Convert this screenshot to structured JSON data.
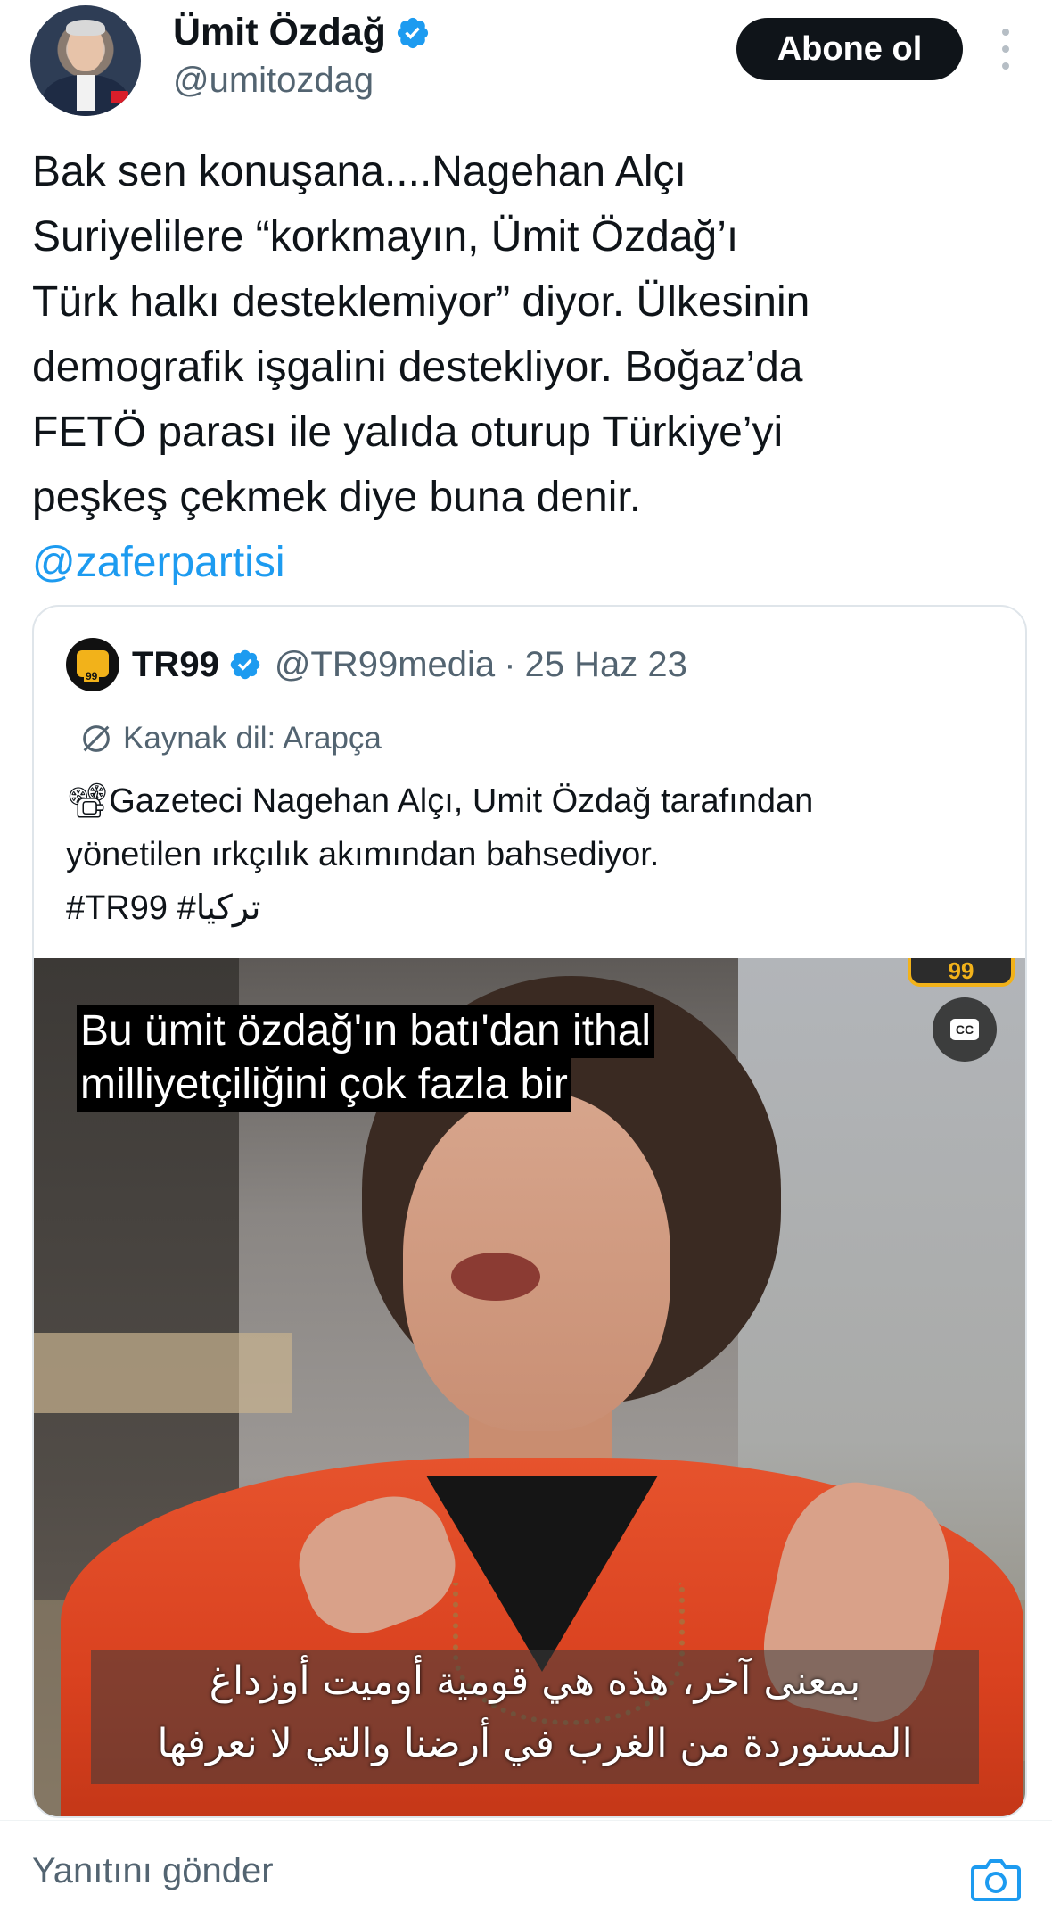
{
  "author": {
    "display_name": "Ümit Özdağ",
    "handle": "@umitozdag",
    "verified_icon": "verified-badge-icon"
  },
  "follow_button": {
    "label": "Abone ol"
  },
  "tweet": {
    "lines": [
      "Bak sen konuşana....Nagehan Alçı",
      "Suriyelilere “korkmayın, Ümit Özdağ’ı",
      "Türk halkı desteklemiyor” diyor. Ülkesinin",
      "demografik işgalini destekliyor. Boğaz’da",
      "FETÖ parası ile yalıda oturup Türkiye’yi",
      "peşkeş çekmek diye buna denir."
    ],
    "mention": "@zaferpartisi"
  },
  "quote": {
    "name": "TR99",
    "handle": "@TR99media",
    "separator": "·",
    "date": "25 Haz 23",
    "avatar_label": "99",
    "source_language": "Kaynak dil: Arapça",
    "text_lines": [
      "📽Gazeteci Nagehan Alçı, Umit Özdağ tarafından",
      "yönetilen ırkçılık akımından bahsediyor."
    ],
    "tags": "#TR99 #تركيا",
    "video": {
      "logo": "99",
      "cc_label": "CC",
      "caption_tr": [
        "Bu ümit özdağ'ın batı'dan ithal",
        "milliyetçiliğini çok fazla bir"
      ],
      "caption_ar": [
        "بمعنى آخر، هذه هي قومية أوميت أوزداغ",
        "المستوردة من الغرب في أرضنا والتي لا نعرفها"
      ]
    }
  },
  "reply": {
    "placeholder": "Yanıtını gönder",
    "camera_icon": "camera-icon"
  },
  "colors": {
    "accent": "#1d9bf0",
    "text": "#0f1419",
    "secondary": "#536471",
    "button_bg": "#0f1419"
  }
}
